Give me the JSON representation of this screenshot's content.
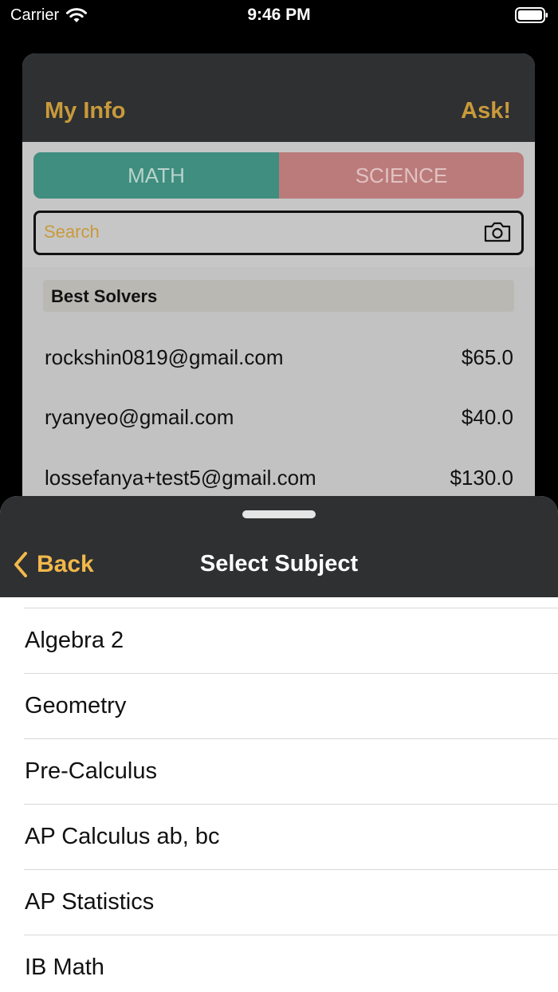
{
  "status_bar": {
    "carrier": "Carrier",
    "time": "9:46 PM"
  },
  "background_screen": {
    "header": {
      "left_label": "My Info",
      "right_label": "Ask!"
    },
    "segments": [
      "MATH",
      "SCIENCE"
    ],
    "search": {
      "placeholder": "Search",
      "value": ""
    },
    "best_solvers": {
      "title": "Best Solvers",
      "rows": [
        {
          "email": "rockshin0819@gmail.com",
          "amount": "$65.0"
        },
        {
          "email": "ryanyeo@gmail.com",
          "amount": "$40.0"
        },
        {
          "email": "lossefanya+test5@gmail.com",
          "amount": "$130.0"
        }
      ]
    }
  },
  "sheet": {
    "back_label": "Back",
    "title": "Select Subject",
    "subjects": [
      "Algebra 2",
      "Geometry",
      "Pre-Calculus",
      "AP Calculus ab, bc",
      "AP Statistics",
      "IB Math"
    ]
  },
  "colors": {
    "accent_gold": "#c99a3a",
    "back_gold": "#f2b84b",
    "header_dark": "#2e3032",
    "math_green": "#3f8e7f",
    "science_red": "#bb7b7b"
  }
}
